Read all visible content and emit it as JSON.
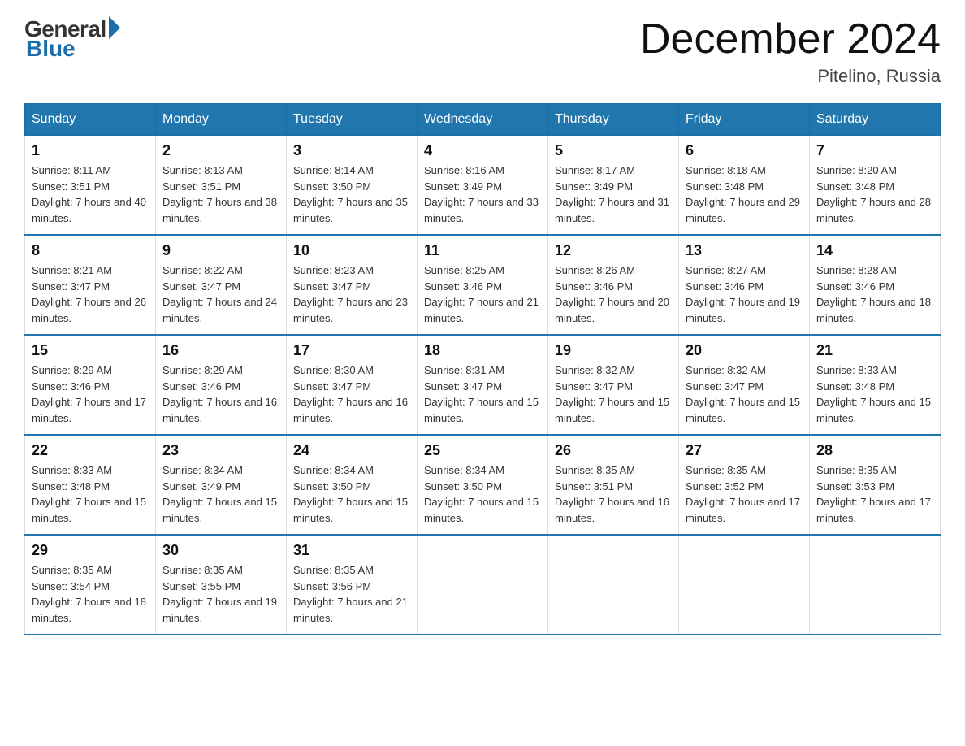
{
  "header": {
    "logo_general": "General",
    "logo_blue": "Blue",
    "title": "December 2024",
    "location": "Pitelino, Russia"
  },
  "weekdays": [
    "Sunday",
    "Monday",
    "Tuesday",
    "Wednesday",
    "Thursday",
    "Friday",
    "Saturday"
  ],
  "weeks": [
    [
      {
        "day": "1",
        "sunrise": "8:11 AM",
        "sunset": "3:51 PM",
        "daylight": "7 hours and 40 minutes."
      },
      {
        "day": "2",
        "sunrise": "8:13 AM",
        "sunset": "3:51 PM",
        "daylight": "7 hours and 38 minutes."
      },
      {
        "day": "3",
        "sunrise": "8:14 AM",
        "sunset": "3:50 PM",
        "daylight": "7 hours and 35 minutes."
      },
      {
        "day": "4",
        "sunrise": "8:16 AM",
        "sunset": "3:49 PM",
        "daylight": "7 hours and 33 minutes."
      },
      {
        "day": "5",
        "sunrise": "8:17 AM",
        "sunset": "3:49 PM",
        "daylight": "7 hours and 31 minutes."
      },
      {
        "day": "6",
        "sunrise": "8:18 AM",
        "sunset": "3:48 PM",
        "daylight": "7 hours and 29 minutes."
      },
      {
        "day": "7",
        "sunrise": "8:20 AM",
        "sunset": "3:48 PM",
        "daylight": "7 hours and 28 minutes."
      }
    ],
    [
      {
        "day": "8",
        "sunrise": "8:21 AM",
        "sunset": "3:47 PM",
        "daylight": "7 hours and 26 minutes."
      },
      {
        "day": "9",
        "sunrise": "8:22 AM",
        "sunset": "3:47 PM",
        "daylight": "7 hours and 24 minutes."
      },
      {
        "day": "10",
        "sunrise": "8:23 AM",
        "sunset": "3:47 PM",
        "daylight": "7 hours and 23 minutes."
      },
      {
        "day": "11",
        "sunrise": "8:25 AM",
        "sunset": "3:46 PM",
        "daylight": "7 hours and 21 minutes."
      },
      {
        "day": "12",
        "sunrise": "8:26 AM",
        "sunset": "3:46 PM",
        "daylight": "7 hours and 20 minutes."
      },
      {
        "day": "13",
        "sunrise": "8:27 AM",
        "sunset": "3:46 PM",
        "daylight": "7 hours and 19 minutes."
      },
      {
        "day": "14",
        "sunrise": "8:28 AM",
        "sunset": "3:46 PM",
        "daylight": "7 hours and 18 minutes."
      }
    ],
    [
      {
        "day": "15",
        "sunrise": "8:29 AM",
        "sunset": "3:46 PM",
        "daylight": "7 hours and 17 minutes."
      },
      {
        "day": "16",
        "sunrise": "8:29 AM",
        "sunset": "3:46 PM",
        "daylight": "7 hours and 16 minutes."
      },
      {
        "day": "17",
        "sunrise": "8:30 AM",
        "sunset": "3:47 PM",
        "daylight": "7 hours and 16 minutes."
      },
      {
        "day": "18",
        "sunrise": "8:31 AM",
        "sunset": "3:47 PM",
        "daylight": "7 hours and 15 minutes."
      },
      {
        "day": "19",
        "sunrise": "8:32 AM",
        "sunset": "3:47 PM",
        "daylight": "7 hours and 15 minutes."
      },
      {
        "day": "20",
        "sunrise": "8:32 AM",
        "sunset": "3:47 PM",
        "daylight": "7 hours and 15 minutes."
      },
      {
        "day": "21",
        "sunrise": "8:33 AM",
        "sunset": "3:48 PM",
        "daylight": "7 hours and 15 minutes."
      }
    ],
    [
      {
        "day": "22",
        "sunrise": "8:33 AM",
        "sunset": "3:48 PM",
        "daylight": "7 hours and 15 minutes."
      },
      {
        "day": "23",
        "sunrise": "8:34 AM",
        "sunset": "3:49 PM",
        "daylight": "7 hours and 15 minutes."
      },
      {
        "day": "24",
        "sunrise": "8:34 AM",
        "sunset": "3:50 PM",
        "daylight": "7 hours and 15 minutes."
      },
      {
        "day": "25",
        "sunrise": "8:34 AM",
        "sunset": "3:50 PM",
        "daylight": "7 hours and 15 minutes."
      },
      {
        "day": "26",
        "sunrise": "8:35 AM",
        "sunset": "3:51 PM",
        "daylight": "7 hours and 16 minutes."
      },
      {
        "day": "27",
        "sunrise": "8:35 AM",
        "sunset": "3:52 PM",
        "daylight": "7 hours and 17 minutes."
      },
      {
        "day": "28",
        "sunrise": "8:35 AM",
        "sunset": "3:53 PM",
        "daylight": "7 hours and 17 minutes."
      }
    ],
    [
      {
        "day": "29",
        "sunrise": "8:35 AM",
        "sunset": "3:54 PM",
        "daylight": "7 hours and 18 minutes."
      },
      {
        "day": "30",
        "sunrise": "8:35 AM",
        "sunset": "3:55 PM",
        "daylight": "7 hours and 19 minutes."
      },
      {
        "day": "31",
        "sunrise": "8:35 AM",
        "sunset": "3:56 PM",
        "daylight": "7 hours and 21 minutes."
      },
      null,
      null,
      null,
      null
    ]
  ],
  "labels": {
    "sunrise": "Sunrise:",
    "sunset": "Sunset:",
    "daylight": "Daylight:"
  }
}
